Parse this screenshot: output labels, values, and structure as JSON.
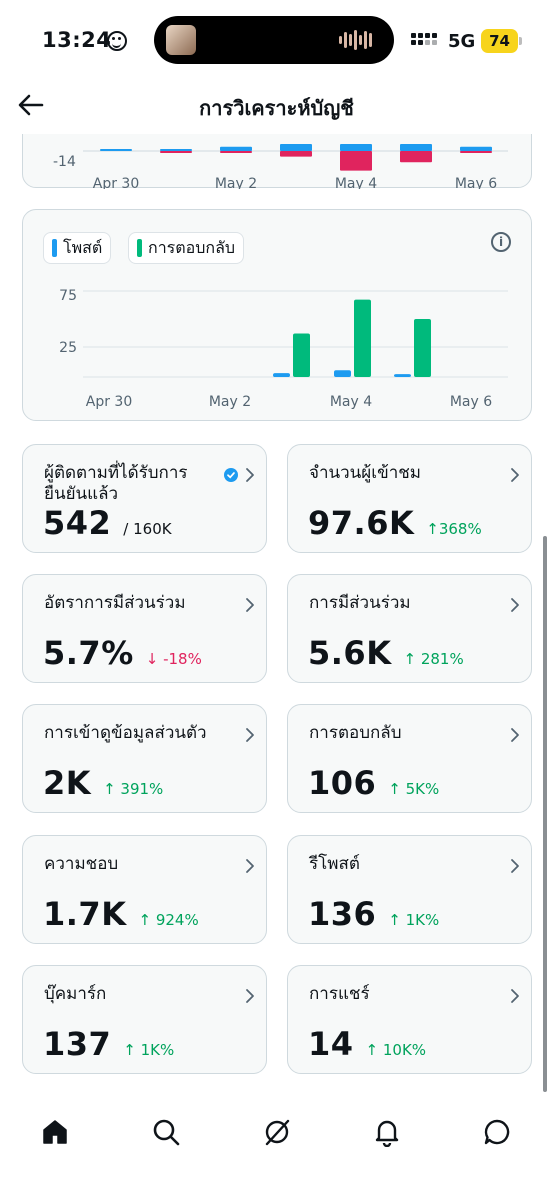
{
  "status_bar": {
    "time": "13:24",
    "network": "5G",
    "battery": "74"
  },
  "header": {
    "title": "การวิเคราะห์บัญชี"
  },
  "top_chart": {
    "chart_data": {
      "type": "bar",
      "categories": [
        "Apr 30",
        "May 1",
        "May 2",
        "May 3",
        "May 4",
        "May 5",
        "May 6"
      ],
      "y_tick_labels": [
        "-14"
      ],
      "x_tick_labels": [
        "Apr 30",
        "May 2",
        "May 4",
        "May 6"
      ],
      "series": [
        {
          "color": "#1d9bf0",
          "values": [
            0.2,
            0.2,
            1.5,
            2.5,
            2.5,
            2.5,
            1.5
          ]
        },
        {
          "color": "#e0245e",
          "values": [
            0,
            -0.3,
            -0.6,
            -2,
            -7,
            -4,
            -0.3
          ]
        }
      ]
    }
  },
  "second_chart": {
    "legend": [
      {
        "label": "โพสต์",
        "color": "#1d9bf0"
      },
      {
        "label": "การตอบกลับ",
        "color": "#00ba7c"
      }
    ],
    "chart_data": {
      "type": "bar",
      "categories": [
        "Apr 30",
        "May 1",
        "May 2",
        "May 3",
        "May 4",
        "May 5",
        "May 6"
      ],
      "y_tick_labels": [
        "75",
        "25"
      ],
      "x_tick_labels": [
        "Apr 30",
        "May 2",
        "May 4",
        "May 6"
      ],
      "ylim": [
        0,
        90
      ],
      "series": [
        {
          "name": "โพสต์",
          "values": [
            0,
            0,
            0,
            4,
            7,
            3,
            0
          ]
        },
        {
          "name": "การตอบกลับ",
          "values": [
            0,
            0,
            0,
            45,
            80,
            60,
            0
          ]
        }
      ]
    }
  },
  "stats": [
    {
      "label": "ผู้ติดตามที่ได้รับการยืนยันแล้ว",
      "value": "542",
      "sub": "/ 160K",
      "verified": true
    },
    {
      "label": "จำนวนผู้เข้าชม",
      "value": "97.6K",
      "delta": "↑368%",
      "dir": "up"
    },
    {
      "label": "อัตราการมีส่วนร่วม",
      "value": "5.7%",
      "delta": "↓ -18%",
      "dir": "down"
    },
    {
      "label": "การมีส่วนร่วม",
      "value": "5.6K",
      "delta": "↑ 281%",
      "dir": "up"
    },
    {
      "label": "การเข้าดูข้อมูลส่วนตัว",
      "value": "2K",
      "delta": "↑ 391%",
      "dir": "up"
    },
    {
      "label": "การตอบกลับ",
      "value": "106",
      "delta": "↑ 5K%",
      "dir": "up"
    },
    {
      "label": "ความชอบ",
      "value": "1.7K",
      "delta": "↑ 924%",
      "dir": "up"
    },
    {
      "label": "รีโพสต์",
      "value": "136",
      "delta": "↑ 1K%",
      "dir": "up"
    },
    {
      "label": "บุ๊คมาร์ก",
      "value": "137",
      "delta": "↑ 1K%",
      "dir": "up"
    },
    {
      "label": "การแชร์",
      "value": "14",
      "delta": "↑ 10K%",
      "dir": "up"
    }
  ],
  "icons": {
    "back": "arrow-left-icon",
    "info": "info-icon",
    "nav": [
      "home-icon",
      "search-icon",
      "grok-icon",
      "notifications-icon",
      "messages-icon"
    ]
  }
}
